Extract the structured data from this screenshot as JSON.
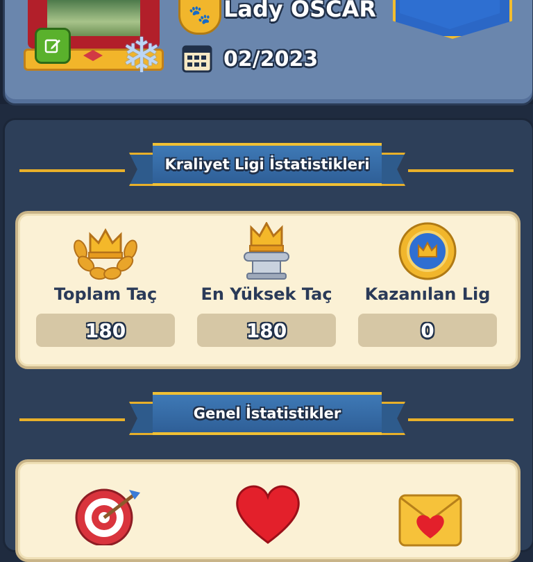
{
  "profile": {
    "player_name": "Lady OSCAR",
    "join_date": "02/2023",
    "badge_icon": "paw-icon",
    "edit_icon": "edit-icon",
    "frame_icon": "snowflake-icon"
  },
  "royal_league": {
    "title": "Kraliyet Ligi İstatistikleri",
    "stats": [
      {
        "label": "Toplam Taç",
        "value": "180",
        "icon": "crown-laurel-icon"
      },
      {
        "label": "En Yüksek Taç",
        "value": "180",
        "icon": "crown-pedestal-icon"
      },
      {
        "label": "Kazanılan Lig",
        "value": "0",
        "icon": "league-medal-icon"
      }
    ]
  },
  "general": {
    "title": "Genel İstatistikler",
    "icons": [
      "target-icon",
      "heart-icon",
      "envelope-heart-icon"
    ]
  },
  "colors": {
    "gold": "#e8b02a",
    "panel_blue": "#6a86ad",
    "dark_panel": "#2d3f59",
    "card_cream": "#fbf1d5"
  }
}
